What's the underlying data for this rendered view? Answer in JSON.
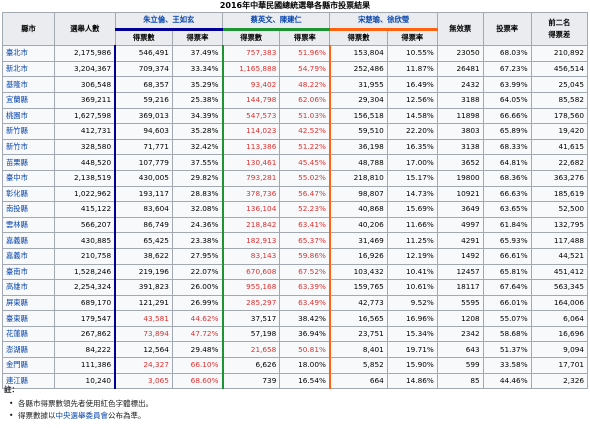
{
  "title": "2016年中華民國總統選舉各縣市投票結果",
  "headers": {
    "county": "縣市",
    "voters": "選舉人數",
    "invalid": "無效票",
    "turnout": "投票率",
    "top2_diff_l1": "前二名",
    "top2_diff_l2": "得票差",
    "votes": "得票數",
    "rate": "得票率"
  },
  "candidates": [
    {
      "names": "朱立倫、王如玄",
      "party_color": "#000095"
    },
    {
      "names": "蔡英文、陳建仁",
      "party_color": "#1b9431"
    },
    {
      "names": "宋楚瑜、徐欣瑩",
      "party_color": "#ff6310"
    }
  ],
  "rows": [
    {
      "county": "臺北市",
      "voters": "2,175,986",
      "c1_votes": "546,491",
      "c1_rate": "37.49%",
      "c2_votes": "757,383",
      "c2_rate": "51.96%",
      "c3_votes": "153,804",
      "c3_rate": "10.55%",
      "invalid": "23050",
      "turnout": "68.03%",
      "diff": "210,892",
      "win": 2
    },
    {
      "county": "新北市",
      "voters": "3,204,367",
      "c1_votes": "709,374",
      "c1_rate": "33.34%",
      "c2_votes": "1,165,888",
      "c2_rate": "54.79%",
      "c3_votes": "252,486",
      "c3_rate": "11.87%",
      "invalid": "26481",
      "turnout": "67.23%",
      "diff": "456,514",
      "win": 2
    },
    {
      "county": "基隆市",
      "voters": "306,548",
      "c1_votes": "68,357",
      "c1_rate": "35.29%",
      "c2_votes": "93,402",
      "c2_rate": "48.22%",
      "c3_votes": "31,955",
      "c3_rate": "16.49%",
      "invalid": "2432",
      "turnout": "63.99%",
      "diff": "25,045",
      "win": 2
    },
    {
      "county": "宜蘭縣",
      "voters": "369,211",
      "c1_votes": "59,216",
      "c1_rate": "25.38%",
      "c2_votes": "144,798",
      "c2_rate": "62.06%",
      "c3_votes": "29,304",
      "c3_rate": "12.56%",
      "invalid": "3188",
      "turnout": "64.05%",
      "diff": "85,582",
      "win": 2
    },
    {
      "county": "桃園市",
      "voters": "1,627,598",
      "c1_votes": "369,013",
      "c1_rate": "34.39%",
      "c2_votes": "547,573",
      "c2_rate": "51.03%",
      "c3_votes": "156,518",
      "c3_rate": "14.58%",
      "invalid": "11898",
      "turnout": "66.66%",
      "diff": "178,560",
      "win": 2
    },
    {
      "county": "新竹縣",
      "voters": "412,731",
      "c1_votes": "94,603",
      "c1_rate": "35.28%",
      "c2_votes": "114,023",
      "c2_rate": "42.52%",
      "c3_votes": "59,510",
      "c3_rate": "22.20%",
      "invalid": "3803",
      "turnout": "65.89%",
      "diff": "19,420",
      "win": 2
    },
    {
      "county": "新竹市",
      "voters": "328,580",
      "c1_votes": "71,771",
      "c1_rate": "32.42%",
      "c2_votes": "113,386",
      "c2_rate": "51.22%",
      "c3_votes": "36,198",
      "c3_rate": "16.35%",
      "invalid": "3138",
      "turnout": "68.33%",
      "diff": "41,615",
      "win": 2
    },
    {
      "county": "苗栗縣",
      "voters": "448,520",
      "c1_votes": "107,779",
      "c1_rate": "37.55%",
      "c2_votes": "130,461",
      "c2_rate": "45.45%",
      "c3_votes": "48,788",
      "c3_rate": "17.00%",
      "invalid": "3652",
      "turnout": "64.81%",
      "diff": "22,682",
      "win": 2
    },
    {
      "county": "臺中市",
      "voters": "2,138,519",
      "c1_votes": "430,005",
      "c1_rate": "29.82%",
      "c2_votes": "793,281",
      "c2_rate": "55.02%",
      "c3_votes": "218,810",
      "c3_rate": "15.17%",
      "invalid": "19800",
      "turnout": "68.36%",
      "diff": "363,276",
      "win": 2
    },
    {
      "county": "彰化縣",
      "voters": "1,022,962",
      "c1_votes": "193,117",
      "c1_rate": "28.83%",
      "c2_votes": "378,736",
      "c2_rate": "56.47%",
      "c3_votes": "98,807",
      "c3_rate": "14.73%",
      "invalid": "10921",
      "turnout": "66.63%",
      "diff": "185,619",
      "win": 2
    },
    {
      "county": "南投縣",
      "voters": "415,122",
      "c1_votes": "83,604",
      "c1_rate": "32.08%",
      "c2_votes": "136,104",
      "c2_rate": "52.23%",
      "c3_votes": "40,868",
      "c3_rate": "15.69%",
      "invalid": "3649",
      "turnout": "63.65%",
      "diff": "52,500",
      "win": 2
    },
    {
      "county": "雲林縣",
      "voters": "566,207",
      "c1_votes": "86,749",
      "c1_rate": "24.36%",
      "c2_votes": "218,842",
      "c2_rate": "63.41%",
      "c3_votes": "40,206",
      "c3_rate": "11.66%",
      "invalid": "4997",
      "turnout": "61.84%",
      "diff": "132,795",
      "win": 2
    },
    {
      "county": "嘉義縣",
      "voters": "430,885",
      "c1_votes": "65,425",
      "c1_rate": "23.38%",
      "c2_votes": "182,913",
      "c2_rate": "65.37%",
      "c3_votes": "31,469",
      "c3_rate": "11.25%",
      "invalid": "4291",
      "turnout": "65.93%",
      "diff": "117,488",
      "win": 2
    },
    {
      "county": "嘉義市",
      "voters": "210,758",
      "c1_votes": "38,622",
      "c1_rate": "27.95%",
      "c2_votes": "83,143",
      "c2_rate": "59.86%",
      "c3_votes": "16,926",
      "c3_rate": "12.19%",
      "invalid": "1492",
      "turnout": "66.61%",
      "diff": "44,521",
      "win": 2
    },
    {
      "county": "臺南市",
      "voters": "1,528,246",
      "c1_votes": "219,196",
      "c1_rate": "22.07%",
      "c2_votes": "670,608",
      "c2_rate": "67.52%",
      "c3_votes": "103,432",
      "c3_rate": "10.41%",
      "invalid": "12457",
      "turnout": "65.81%",
      "diff": "451,412",
      "win": 2
    },
    {
      "county": "高雄市",
      "voters": "2,254,324",
      "c1_votes": "391,823",
      "c1_rate": "26.00%",
      "c2_votes": "955,168",
      "c2_rate": "63.39%",
      "c3_votes": "159,765",
      "c3_rate": "10.61%",
      "invalid": "18117",
      "turnout": "67.64%",
      "diff": "563,345",
      "win": 2
    },
    {
      "county": "屏東縣",
      "voters": "689,170",
      "c1_votes": "121,291",
      "c1_rate": "26.99%",
      "c2_votes": "285,297",
      "c2_rate": "63.49%",
      "c3_votes": "42,773",
      "c3_rate": "9.52%",
      "invalid": "5595",
      "turnout": "66.01%",
      "diff": "164,006",
      "win": 2
    },
    {
      "county": "臺東縣",
      "voters": "179,547",
      "c1_votes": "43,581",
      "c1_rate": "44.62%",
      "c2_votes": "37,517",
      "c2_rate": "38.42%",
      "c3_votes": "16,565",
      "c3_rate": "16.96%",
      "invalid": "1208",
      "turnout": "55.07%",
      "diff": "6,064",
      "win": 1
    },
    {
      "county": "花蓮縣",
      "voters": "267,862",
      "c1_votes": "73,894",
      "c1_rate": "47.72%",
      "c2_votes": "57,198",
      "c2_rate": "36.94%",
      "c3_votes": "23,751",
      "c3_rate": "15.34%",
      "invalid": "2342",
      "turnout": "58.68%",
      "diff": "16,696",
      "win": 1
    },
    {
      "county": "澎湖縣",
      "voters": "84,222",
      "c1_votes": "12,564",
      "c1_rate": "29.48%",
      "c2_votes": "21,658",
      "c2_rate": "50.81%",
      "c3_votes": "8,401",
      "c3_rate": "19.71%",
      "invalid": "643",
      "turnout": "51.37%",
      "diff": "9,094",
      "win": 2
    },
    {
      "county": "金門縣",
      "voters": "111,386",
      "c1_votes": "24,327",
      "c1_rate": "66.10%",
      "c2_votes": "6,626",
      "c2_rate": "18.00%",
      "c3_votes": "5,852",
      "c3_rate": "15.90%",
      "invalid": "599",
      "turnout": "33.58%",
      "diff": "17,701",
      "win": 1
    },
    {
      "county": "連江縣",
      "voters": "10,240",
      "c1_votes": "3,065",
      "c1_rate": "68.60%",
      "c2_votes": "739",
      "c2_rate": "16.54%",
      "c3_votes": "664",
      "c3_rate": "14.86%",
      "invalid": "85",
      "turnout": "44.46%",
      "diff": "2,326",
      "win": 1
    }
  ],
  "notes": {
    "label": "註：",
    "bullet": "•",
    "items": [
      {
        "text": "各縣市得票數領先者使用紅色字體標出。"
      },
      {
        "prefix": "得票數據以",
        "link": "中央選舉委員會",
        "suffix": "公布為準。"
      }
    ]
  },
  "colors": {
    "leader_text": "#dd3333",
    "link": "#0645ad",
    "header_bg": "#eaecf0",
    "cell_bg": "#f8f9fa"
  }
}
